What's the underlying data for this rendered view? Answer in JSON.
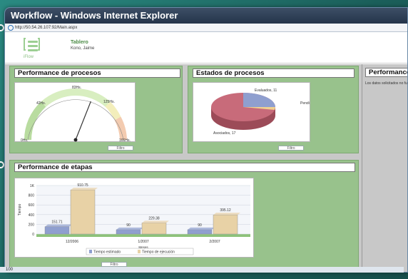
{
  "window": {
    "title": "Workflow - Windows Internet Explorer",
    "url": "http://50.54.26.107:92/Main.aspx",
    "status": "100"
  },
  "header": {
    "logo_text": "iFlow",
    "page_title": "Tablero",
    "user": "Kono, Jaime"
  },
  "panels": {
    "procesos": {
      "title": "Performance de procesos",
      "filter": "Filtro"
    },
    "estados": {
      "title": "Estados de procesos",
      "filter": "Filtro"
    },
    "etapas": {
      "title": "Performance de etapas",
      "filter": "Filtro"
    },
    "right": {
      "title": "Performance",
      "message": "Los datos solicitados no fu"
    }
  },
  "gauge": {
    "min_label": "0Hs.",
    "low_label": "42Hs.",
    "mid_label": "83Hs.",
    "high_label": "125Hs.",
    "max_label": "166Hs.",
    "value": 0.62
  },
  "pie": {
    "slices": [
      {
        "label": "Evaluados, 11",
        "value": 11,
        "color": "#8f9fcf"
      },
      {
        "label": "Pendi",
        "value": 0.3,
        "color": "#f0d090"
      },
      {
        "label": "Asociados, 17",
        "value": 17,
        "color": "#c86b7a"
      }
    ]
  },
  "chart_data": {
    "type": "bar",
    "categories": [
      "12/2006",
      "1/2007",
      "2/2007"
    ],
    "series": [
      {
        "name": "Tiempo estimado",
        "values": [
          151.71,
          90,
          90
        ],
        "color": "#8f9fcf"
      },
      {
        "name": "Tiempo de ejecución",
        "values": [
          910.75,
          229.38,
          395.12
        ],
        "color": "#e8d2a6"
      }
    ],
    "data_labels": [
      [
        "151.71",
        "910.75"
      ],
      [
        "90",
        "229.38"
      ],
      [
        "90",
        "395.12"
      ]
    ],
    "yticks": [
      "1K",
      "800",
      "600",
      "400",
      "200",
      "0"
    ],
    "ylim": [
      0,
      1000
    ],
    "xlabel": "Meses",
    "ylabel": "Tiempo"
  }
}
